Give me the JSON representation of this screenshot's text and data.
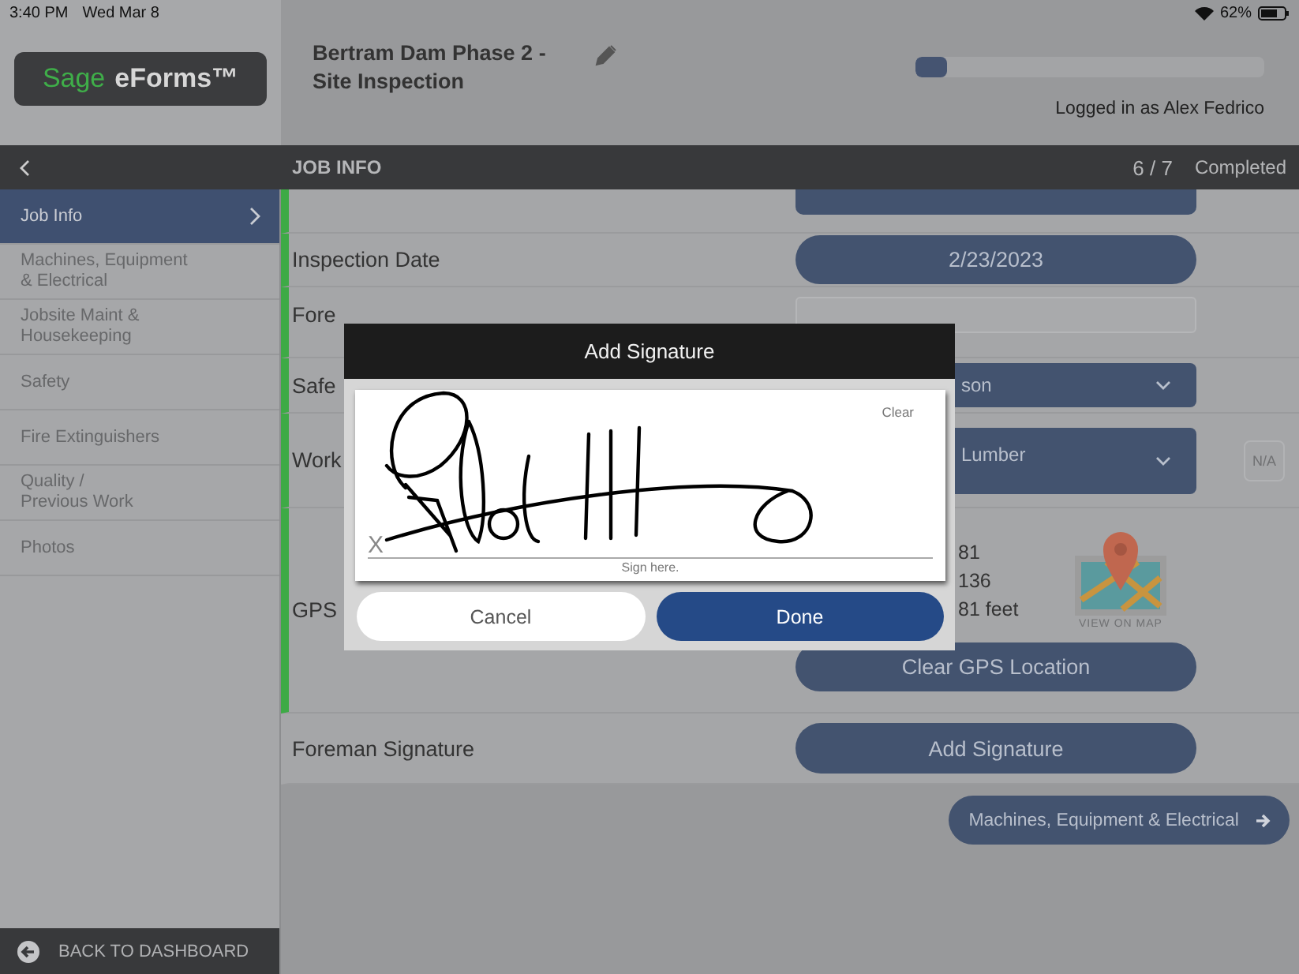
{
  "status_bar": {
    "time": "3:40 PM",
    "date": "Wed Mar 8",
    "battery": "62%"
  },
  "header": {
    "logo": {
      "brand": "Sage",
      "product": "eForms™"
    },
    "form_title": "Bertram Dam Phase 2 - Site Inspection",
    "progress": {
      "level": 0.09
    },
    "user": "Logged in as Alex Fedrico"
  },
  "nav": {
    "section": "JOB INFO",
    "count": "6 / 7",
    "status": "Completed"
  },
  "sidebar": {
    "items": [
      {
        "label": "Job Info",
        "selected": true
      },
      {
        "label": "Machines, Equipment\n& Electrical",
        "selected": false
      },
      {
        "label": "Jobsite Maint &\nHousekeeping",
        "selected": false
      },
      {
        "label": "Safety",
        "selected": false
      },
      {
        "label": "Fire Extinguishers",
        "selected": false
      },
      {
        "label": "Quality /\nPrevious Work",
        "selected": false
      },
      {
        "label": "Photos",
        "selected": false
      }
    ],
    "back": "BACK TO DASHBOARD"
  },
  "form": {
    "rows": [
      {
        "kind": "partial",
        "complete": true
      },
      {
        "kind": "date",
        "label": "Inspection Date",
        "value": "2/23/2023",
        "complete": true
      },
      {
        "kind": "input",
        "label": "Fore",
        "complete": true
      },
      {
        "kind": "select",
        "label": "Safe",
        "value": "son",
        "complete": true
      },
      {
        "kind": "select",
        "label": "Work",
        "value": "Lumber",
        "na": "N/A",
        "complete": true
      },
      {
        "kind": "gps",
        "label": "GPS",
        "readings": [
          "81",
          "136",
          "81 feet"
        ],
        "map_caption": "VIEW ON MAP",
        "action": "Clear GPS Location",
        "complete": true
      },
      {
        "kind": "button",
        "label": "Foreman Signature",
        "value": "Add Signature",
        "complete": false
      }
    ],
    "next": "Machines, Equipment & Electrical"
  },
  "dialog": {
    "title": "Add Signature",
    "clear": "Clear",
    "mark": "X",
    "hint": "Sign here.",
    "buttons": [
      {
        "label": "Cancel",
        "kind": "secondary"
      },
      {
        "label": "Done",
        "kind": "primary"
      }
    ]
  }
}
